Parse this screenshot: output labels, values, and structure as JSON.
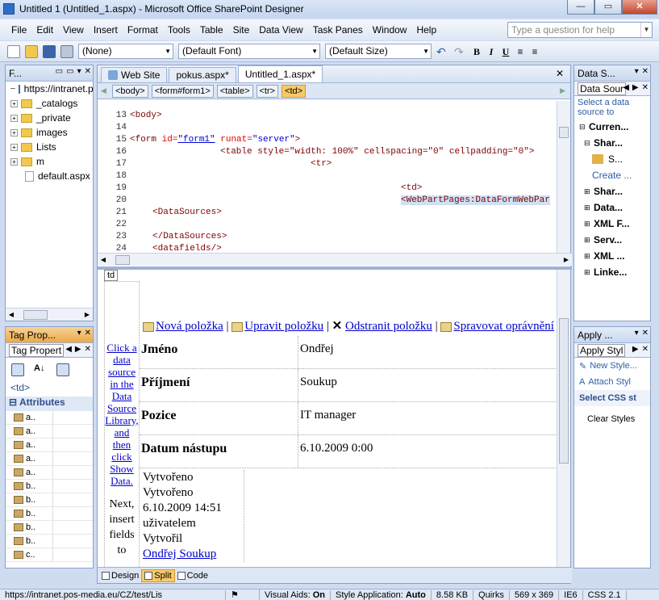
{
  "window": {
    "title": "Untitled 1 (Untitled_1.aspx) - Microsoft Office SharePoint Designer",
    "min": "—",
    "max": "▭",
    "close": "✕"
  },
  "menu": [
    "File",
    "Edit",
    "View",
    "Insert",
    "Format",
    "Tools",
    "Table",
    "Site",
    "Data View",
    "Task Panes",
    "Window",
    "Help"
  ],
  "help_placeholder": "Type a question for help",
  "toolbar": {
    "style": "(None)",
    "font": "(Default Font)",
    "size": "(Default Size)",
    "bold": "B",
    "italic": "I",
    "underline": "U"
  },
  "folder_list": {
    "title": "F...",
    "root": "https://intranet.p",
    "items": [
      "_catalogs",
      "_private",
      "images",
      "Lists",
      "m"
    ],
    "file": "default.aspx"
  },
  "tag_properties": {
    "title": "Tag Prop...",
    "tab": "Tag Propert",
    "tag": "<td>",
    "section": "Attributes",
    "attrs": [
      "a..",
      "a..",
      "a..",
      "a..",
      "a..",
      "b..",
      "b..",
      "b..",
      "b..",
      "b..",
      "c.."
    ]
  },
  "tabs": [
    "Web Site",
    "pokus.aspx*",
    "Untitled_1.aspx*"
  ],
  "breadcrumbs": [
    "<body>",
    "<form#form1>",
    "<table>",
    "<tr>",
    "<td>"
  ],
  "code": {
    "lines": [
      "13",
      "14",
      "15",
      "16",
      "17",
      "18",
      "19",
      "20",
      "21",
      "22",
      "23",
      "24"
    ],
    "l13": "<body>",
    "l15a": "<form ",
    "l15b": "id=",
    "l15c": "\"form1\"",
    "l15d": " runat=",
    "l15e": "\"server\"",
    "l15f": ">",
    "l16": "<table style=\"width: 100%\" cellspacing=\"0\" cellpadding=\"0\">",
    "l17": "<tr>",
    "l18": "<td>",
    "l19": "<WebPartPages:DataFormWebPar",
    "l20": "<DataSources>",
    "l22": "</DataSources>",
    "l24": "<datafields/>"
  },
  "design": {
    "td_tag": "td",
    "side_link": "Click a data source in the Data Source Library, and then click Show Data.",
    "side_text": "Next, insert fields to",
    "actions": {
      "new": "Nová položka",
      "edit": "Upravit položku",
      "delete": "Odstranit položku",
      "manage": "Spravovat oprávnění"
    },
    "fields": [
      {
        "label": "Jméno",
        "value": "Ondřej"
      },
      {
        "label": "Příjmení",
        "value": "Soukup"
      },
      {
        "label": "Pozice",
        "value": "IT manager"
      },
      {
        "label": "Datum nástupu",
        "value": "6.10.2009 0:00"
      }
    ],
    "footer": [
      "Vytvořeno",
      "Vytvořeno",
      "6.10.2009 14:51",
      "uživatelem",
      "Vytvořil"
    ],
    "footer_link": "Ondřej Soukup"
  },
  "views": {
    "design": "Design",
    "split": "Split",
    "code": "Code"
  },
  "data_source": {
    "title": "Data S...",
    "tab": "Data Sour",
    "hint": "Select a data source to",
    "items": [
      "Curren...",
      "Shar...",
      "S...",
      "Create ...",
      "Shar...",
      "Data...",
      "XML F...",
      "Serv...",
      "XML ...",
      "Linke..."
    ]
  },
  "apply_styles": {
    "title": "Apply ...",
    "tab": "Apply Styl",
    "new": "New Style...",
    "attach": "Attach Styl",
    "select": "Select CSS st",
    "clear": "Clear Styles"
  },
  "status": {
    "url": "https://intranet.pos-media.eu/CZ/test/Lis",
    "visual_aids_label": "Visual Aids:",
    "visual_aids": "On",
    "style_app_label": "Style Application:",
    "style_app": "Auto",
    "size": "8.58 KB",
    "mode": "Quirks",
    "dims": "569 x 369",
    "browser": "IE6",
    "css": "CSS 2.1"
  }
}
